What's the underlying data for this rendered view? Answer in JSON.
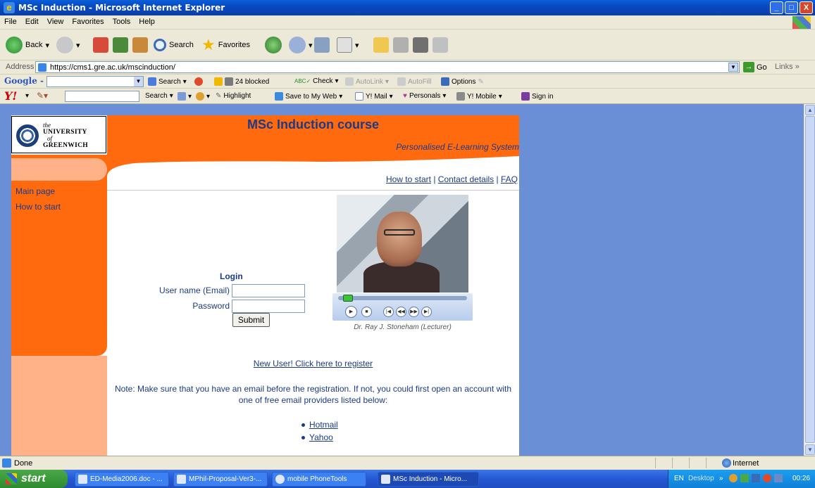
{
  "window": {
    "title": "MSc Induction - Microsoft Internet Explorer",
    "min": "_",
    "max": "□",
    "close": "X"
  },
  "menu": [
    "File",
    "Edit",
    "View",
    "Favorites",
    "Tools",
    "Help"
  ],
  "toolbar": {
    "back": "Back",
    "search": "Search",
    "favorites": "Favorites"
  },
  "address": {
    "label": "Address",
    "url": "https://cms1.gre.ac.uk/mscinduction/",
    "go": "Go",
    "links": "Links »"
  },
  "google_bar": {
    "logo": "Google -",
    "search": "Search",
    "blocked": "24 blocked",
    "check": "Check",
    "autolink": "AutoLink",
    "autofill": "AutoFill",
    "options": "Options"
  },
  "yahoo_bar": {
    "logo": "Y!",
    "search": "Search",
    "highlight": "Highlight",
    "save": "Save to My Web",
    "mail": "Y! Mail",
    "personals": "Personals",
    "mobile": "Y! Mobile",
    "signin": "Sign in"
  },
  "page": {
    "logo": {
      "the": "the",
      "university": "UNIVERSITY",
      "of": "of",
      "greenwich": "GREENWICH"
    },
    "title": "MSc Induction course",
    "subtitle": "Personalised E-Learning System",
    "top_links": {
      "how_to_start": "How to start",
      "sep": " | ",
      "contact": "Contact details",
      "faq": "FAQ"
    },
    "nav": [
      "Main page",
      "How to start"
    ],
    "login": {
      "title": "Login",
      "user_label": "User name (Email)",
      "password_label": "Password",
      "user_value": "",
      "password_value": "",
      "submit": "Submit"
    },
    "video_caption": "Dr. Ray J. Stoneham (Lecturer)",
    "video_progress": 0.04,
    "register_link": "New User! Click here to register",
    "note": "Note: Make sure that you have an email before the registration. If not, you could first open an account with one of free email providers listed below:",
    "providers": [
      "Hotmail",
      "Yahoo"
    ]
  },
  "status": {
    "text": "Done",
    "zone": "Internet"
  },
  "taskbar": {
    "start": "start",
    "tasks": [
      "ED-Media2006.doc - ...",
      "MPhil-Proposal-Ver3-...",
      "mobile PhoneTools",
      "MSc Induction - Micro..."
    ],
    "tray": {
      "lang": "EN",
      "desktop": "Desktop",
      "chevron": "»",
      "clock": "00:26"
    }
  }
}
